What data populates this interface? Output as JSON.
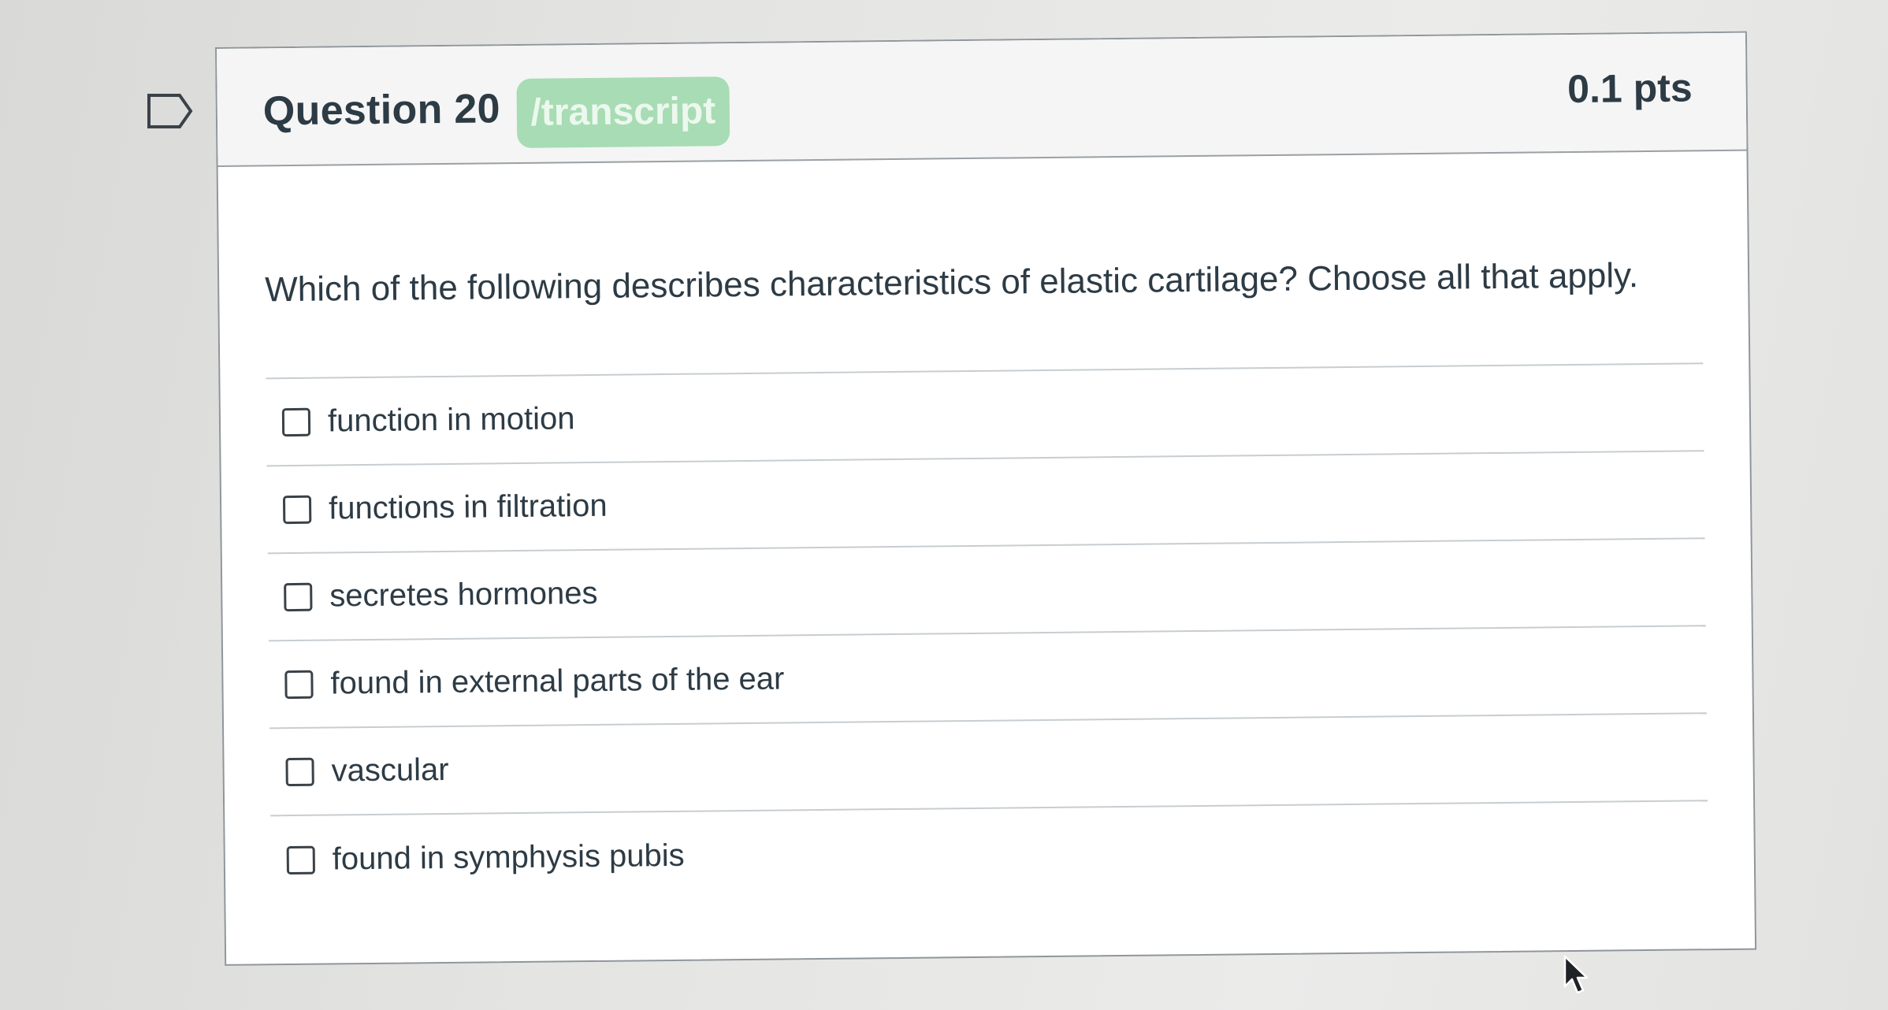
{
  "question": {
    "title": "Question 20",
    "badge": "/transcript",
    "points": "0.1 pts",
    "prompt": "Which of the following describes characteristics of elastic cartilage?  Choose all that apply."
  },
  "answers": [
    {
      "label": "function in motion",
      "checked": false
    },
    {
      "label": "functions in filtration",
      "checked": false
    },
    {
      "label": "secretes hormones",
      "checked": false
    },
    {
      "label": "found in external parts of the ear",
      "checked": false
    },
    {
      "label": "vascular",
      "checked": false
    },
    {
      "label": "found in symphysis pubis",
      "checked": false
    }
  ],
  "icons": {
    "flag": "bookmark-flag-icon",
    "cursor": "mouse-pointer-icon"
  },
  "colors": {
    "badge": "#a8dcb4",
    "text": "#2d3b45",
    "header_background": "#f5f5f5"
  }
}
